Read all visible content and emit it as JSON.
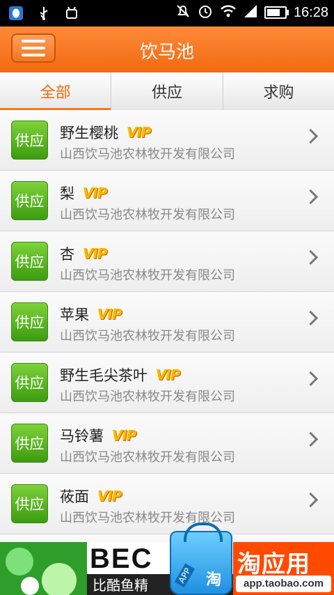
{
  "status_bar": {
    "time": "16:28",
    "icons_left": [
      "qq-icon",
      "usb-icon",
      "android-debug-icon"
    ],
    "icons_right": [
      "mute-icon",
      "alarm-icon",
      "wifi-icon",
      "signal-icon",
      "battery-icon"
    ]
  },
  "header": {
    "title": "饮马池",
    "menu_icon": "menu-icon"
  },
  "tabs": [
    {
      "label": "全部",
      "active": true
    },
    {
      "label": "供应",
      "active": false
    },
    {
      "label": "求购",
      "active": false
    }
  ],
  "list": {
    "items": [
      {
        "badge": "供应",
        "name": "野生樱桃",
        "vip": "VIP",
        "company": "山西饮马池农林牧开发有限公司"
      },
      {
        "badge": "供应",
        "name": "梨",
        "vip": "VIP",
        "company": "山西饮马池农林牧开发有限公司"
      },
      {
        "badge": "供应",
        "name": "杏",
        "vip": "VIP",
        "company": "山西饮马池农林牧开发有限公司"
      },
      {
        "badge": "供应",
        "name": "苹果",
        "vip": "VIP",
        "company": "山西饮马池农林牧开发有限公司"
      },
      {
        "badge": "供应",
        "name": "野生毛尖茶叶",
        "vip": "VIP",
        "company": "山西饮马池农林牧开发有限公司"
      },
      {
        "badge": "供应",
        "name": "马铃薯",
        "vip": "VIP",
        "company": "山西饮马池农林牧开发有限公司"
      },
      {
        "badge": "供应",
        "name": "莜面",
        "vip": "VIP",
        "company": "山西饮马池农林牧开发有限公司"
      }
    ]
  },
  "ad_banner": {
    "middle_text": "BEC",
    "middle_sub": "比酷鱼精",
    "bag_app": "APP",
    "bag_tao": "淘",
    "right_title": "淘应用",
    "right_url": "app.taobao.com"
  },
  "colors": {
    "accent": "#f26a10",
    "badge_green": "#4caf1a",
    "vip_gold": "#ffb400",
    "ad_orange": "#ff4a00"
  }
}
